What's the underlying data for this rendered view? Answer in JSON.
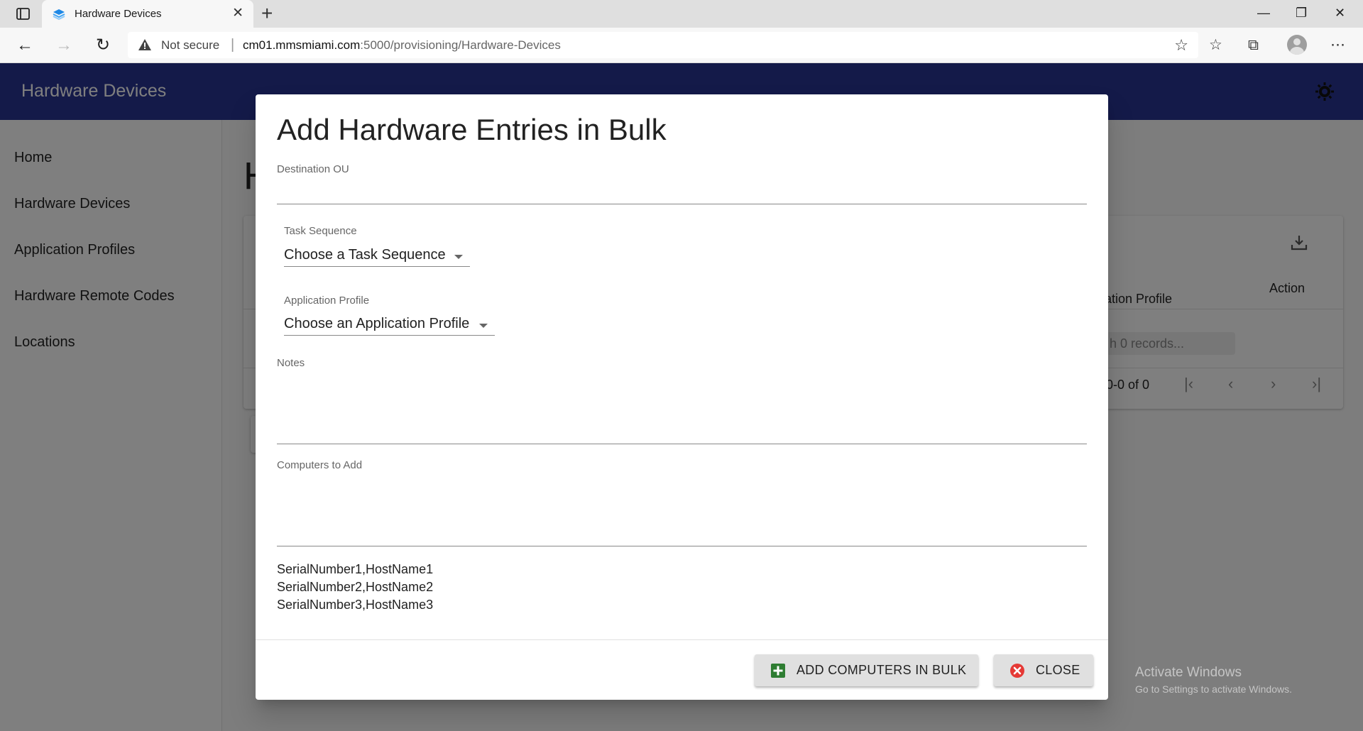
{
  "browser": {
    "tab_title": "Hardware Devices",
    "security_label": "Not secure",
    "url_host": "cm01.mmsmiami.com",
    "url_rest": ":5000/provisioning/Hardware-Devices"
  },
  "app": {
    "title": "Hardware Devices",
    "page_title_partial": "H",
    "nav": [
      "Home",
      "Hardware Devices",
      "Application Profiles",
      "Hardware Remote Codes",
      "Locations"
    ],
    "table": {
      "col_app_profile_partial": "ation Profile",
      "col_action": "Action",
      "search_partial": "h 0 records...",
      "pager_partial": "0-0 of 0"
    }
  },
  "dialog": {
    "title": "Add Hardware Entries in Bulk",
    "destination_ou_label": "Destination OU",
    "task_sequence_label": "Task Sequence",
    "task_sequence_value": "Choose a Task Sequence",
    "app_profile_label": "Application Profile",
    "app_profile_value": "Choose an Application Profile",
    "notes_label": "Notes",
    "computers_label": "Computers to Add",
    "example_lines": [
      "SerialNumber1,HostName1",
      "SerialNumber2,HostName2",
      "SerialNumber3,HostName3"
    ],
    "add_button": "ADD COMPUTERS IN BULK",
    "close_button": "CLOSE"
  },
  "watermark": {
    "line1": "Activate Windows",
    "line2": "Go to Settings to activate Windows."
  },
  "colors": {
    "appbar": "#283593",
    "add_icon": "#2e7d32",
    "close_icon": "#e53935"
  }
}
